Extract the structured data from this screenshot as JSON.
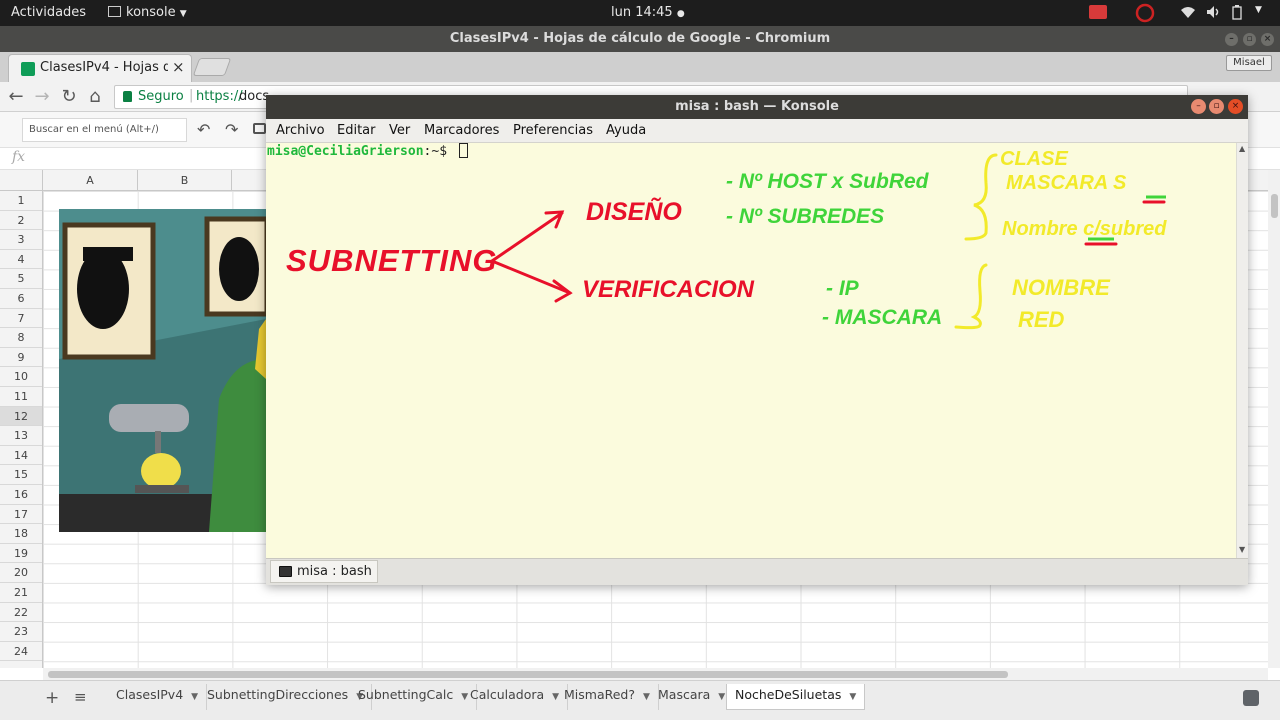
{
  "system_bar": {
    "activities": "Actividades",
    "app_name": "konsole",
    "clock": "lun 14:45"
  },
  "browser": {
    "window_title": "ClasesIPv4 - Hojas de cálculo de Google - Chromium",
    "tab_title": "ClasesIPv4 - Hojas d",
    "profile_name": "Misael",
    "secure_label": "Seguro",
    "url_prefix": "https://",
    "url_visible": "docs"
  },
  "sheets": {
    "menu_search_placeholder": "Buscar en el menú (Alt+/)",
    "fx_label": "fx",
    "columns": [
      "A",
      "B"
    ],
    "rows": [
      "1",
      "2",
      "3",
      "4",
      "5",
      "6",
      "7",
      "8",
      "9",
      "10",
      "11",
      "12",
      "13",
      "14",
      "15",
      "16",
      "17",
      "18",
      "19",
      "20",
      "21",
      "22",
      "23",
      "24"
    ],
    "selected_row": "12",
    "sheet_tabs": [
      "ClasesIPv4",
      "SubnettingDirecciones",
      "SubnettingCalc",
      "Calculadora",
      "MismaRed?",
      "Mascara",
      "NocheDeSiluetas"
    ],
    "active_sheet": "NocheDeSiluetas"
  },
  "konsole": {
    "window_title": "misa : bash — Konsole",
    "menu": [
      "Archivo",
      "Editar",
      "Ver",
      "Marcadores",
      "Preferencias",
      "Ayuda"
    ],
    "prompt_user_host": "misa@CeciliaGrierson",
    "prompt_path": ":~$",
    "tab_label": "misa : bash"
  },
  "annotations": {
    "main": "SUBNETTING",
    "branch_top": "DISEÑO",
    "branch_bottom": "VERIFICACION",
    "top_items": [
      "- Nº HOST x SubRed",
      "- Nº SUBREDES"
    ],
    "top_results": [
      "CLASE",
      "MASCARA S",
      "Nombre c/subred"
    ],
    "bottom_items": [
      "- IP",
      "- MASCARA"
    ],
    "bottom_results": [
      "NOMBRE",
      "RED"
    ],
    "colors": {
      "red": "#e8102a",
      "green": "#3fd43a",
      "yellow": "#f2ea2a"
    }
  }
}
